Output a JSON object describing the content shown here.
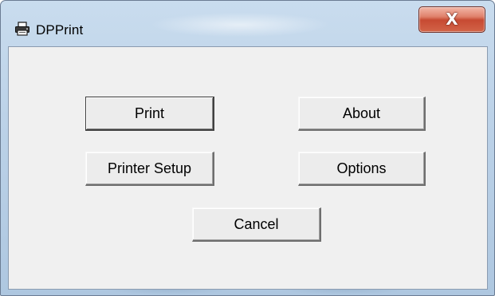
{
  "window": {
    "title": "DPPrint",
    "icon": "printer-icon",
    "close_label": "X"
  },
  "buttons": {
    "print": "Print",
    "about": "About",
    "printer_setup": "Printer Setup",
    "options": "Options",
    "cancel": "Cancel"
  }
}
